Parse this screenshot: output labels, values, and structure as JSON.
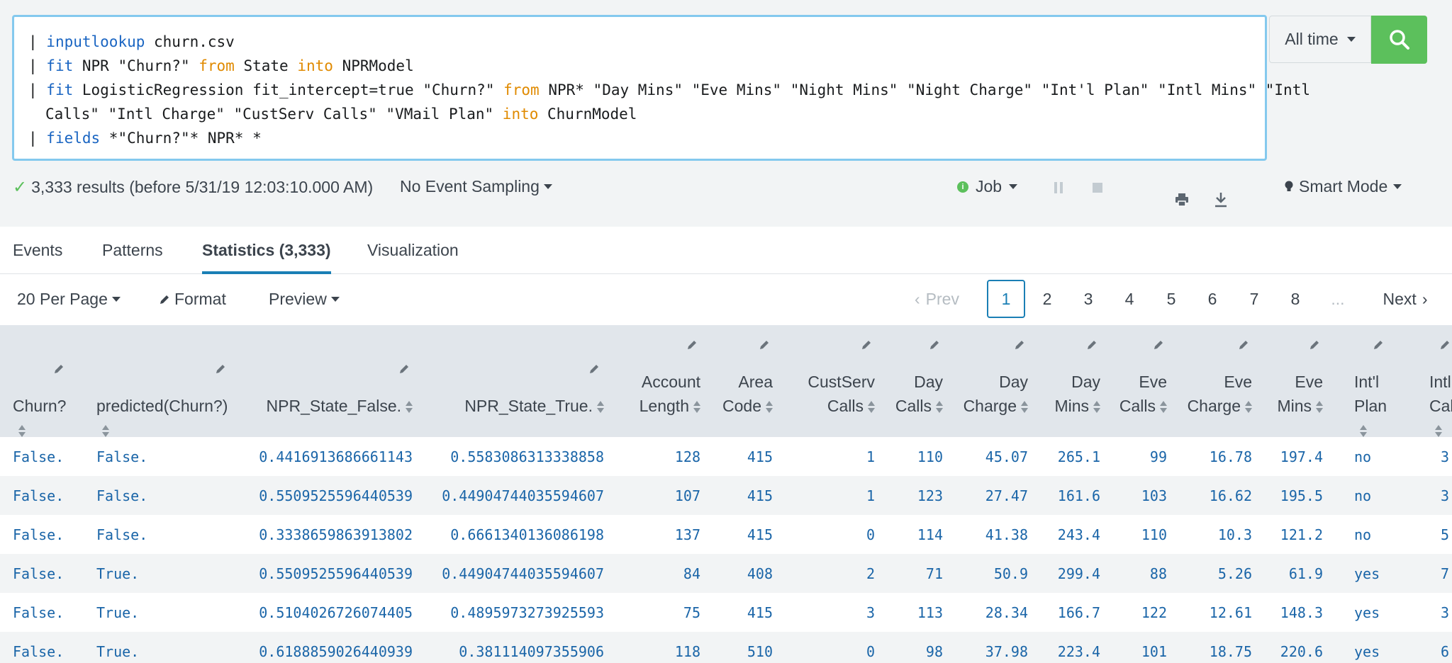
{
  "search": {
    "lines": [
      [
        {
          "t": "| "
        },
        {
          "t": "inputlookup",
          "c": "cmd"
        },
        {
          "t": " churn.csv"
        }
      ],
      [
        {
          "t": "| "
        },
        {
          "t": "fit",
          "c": "cmd"
        },
        {
          "t": " NPR \"Churn?\" "
        },
        {
          "t": "from",
          "c": "arg"
        },
        {
          "t": " State "
        },
        {
          "t": "into",
          "c": "arg"
        },
        {
          "t": " NPRModel"
        }
      ],
      [
        {
          "t": "| "
        },
        {
          "t": "fit",
          "c": "cmd"
        },
        {
          "t": " LogisticRegression fit_intercept=true \"Churn?\" "
        },
        {
          "t": "from",
          "c": "arg"
        },
        {
          "t": " NPR* \"Day Mins\" \"Eve Mins\" \"Night Mins\" \"Night Charge\" \"Int'l Plan\" \"Intl Mins\" \"Intl"
        }
      ],
      [
        {
          "t": "Calls\" \"Intl Charge\" \"CustServ Calls\" \"VMail Plan\" "
        },
        {
          "t": "into",
          "c": "arg"
        },
        {
          "t": " ChurnModel"
        }
      ],
      [
        {
          "t": "| "
        },
        {
          "t": "fields",
          "c": "cmd"
        },
        {
          "t": " *\"Churn?\"* NPR* *"
        }
      ]
    ],
    "time_range": "All time"
  },
  "status": {
    "results": "3,333 results (before 5/31/19 12:03:10.000 AM)",
    "sampling": "No Event Sampling",
    "job": "Job",
    "mode": "Smart Mode"
  },
  "tabs": [
    "Events",
    "Patterns",
    "Statistics (3,333)",
    "Visualization"
  ],
  "toolbar": {
    "per_page": "20 Per Page",
    "format": "Format",
    "preview": "Preview",
    "prev": "Prev",
    "next": "Next",
    "pages": [
      "1",
      "2",
      "3",
      "4",
      "5",
      "6",
      "7",
      "8"
    ],
    "ellipsis": "...",
    "current_page": "1"
  },
  "table": {
    "columns": [
      {
        "key": "churn",
        "lines": [
          "Churn?"
        ]
      },
      {
        "key": "pred",
        "lines": [
          "predicted(Churn?)"
        ]
      },
      {
        "key": "nprf",
        "lines": [
          "NPR_State_False."
        ]
      },
      {
        "key": "nprt",
        "lines": [
          "NPR_State_True."
        ]
      },
      {
        "key": "acct",
        "lines": [
          "Account",
          "Length"
        ]
      },
      {
        "key": "area",
        "lines": [
          "Area",
          "Code"
        ]
      },
      {
        "key": "cust",
        "lines": [
          "CustServ",
          "Calls"
        ]
      },
      {
        "key": "dcalls",
        "lines": [
          "Day",
          "Calls"
        ]
      },
      {
        "key": "dcharge",
        "lines": [
          "Day",
          "Charge"
        ]
      },
      {
        "key": "dmins",
        "lines": [
          "Day",
          "Mins"
        ]
      },
      {
        "key": "ecalls",
        "lines": [
          "Eve",
          "Calls"
        ]
      },
      {
        "key": "echarge",
        "lines": [
          "Eve",
          "Charge"
        ]
      },
      {
        "key": "emins",
        "lines": [
          "Eve",
          "Mins"
        ]
      },
      {
        "key": "iplan",
        "lines": [
          "Int'l",
          "Plan"
        ]
      },
      {
        "key": "icalls",
        "lines": [
          "Intl",
          "Calls"
        ]
      }
    ],
    "rows": [
      [
        "False.",
        "False.",
        "0.4416913686661143",
        "0.5583086313338858",
        "128",
        "415",
        "1",
        "110",
        "45.07",
        "265.1",
        "99",
        "16.78",
        "197.4",
        "no",
        "3"
      ],
      [
        "False.",
        "False.",
        "0.5509525596440539",
        "0.44904744035594607",
        "107",
        "415",
        "1",
        "123",
        "27.47",
        "161.6",
        "103",
        "16.62",
        "195.5",
        "no",
        "3"
      ],
      [
        "False.",
        "False.",
        "0.3338659863913802",
        "0.6661340136086198",
        "137",
        "415",
        "0",
        "114",
        "41.38",
        "243.4",
        "110",
        "10.3",
        "121.2",
        "no",
        "5"
      ],
      [
        "False.",
        "True.",
        "0.5509525596440539",
        "0.44904744035594607",
        "84",
        "408",
        "2",
        "71",
        "50.9",
        "299.4",
        "88",
        "5.26",
        "61.9",
        "yes",
        "7"
      ],
      [
        "False.",
        "True.",
        "0.5104026726074405",
        "0.4895973273925593",
        "75",
        "415",
        "3",
        "113",
        "28.34",
        "166.7",
        "122",
        "12.61",
        "148.3",
        "yes",
        "3"
      ],
      [
        "False.",
        "True.",
        "0.6188859026440939",
        "0.381114097355906",
        "118",
        "510",
        "0",
        "98",
        "37.98",
        "223.4",
        "101",
        "18.75",
        "220.6",
        "yes",
        "6"
      ]
    ]
  }
}
